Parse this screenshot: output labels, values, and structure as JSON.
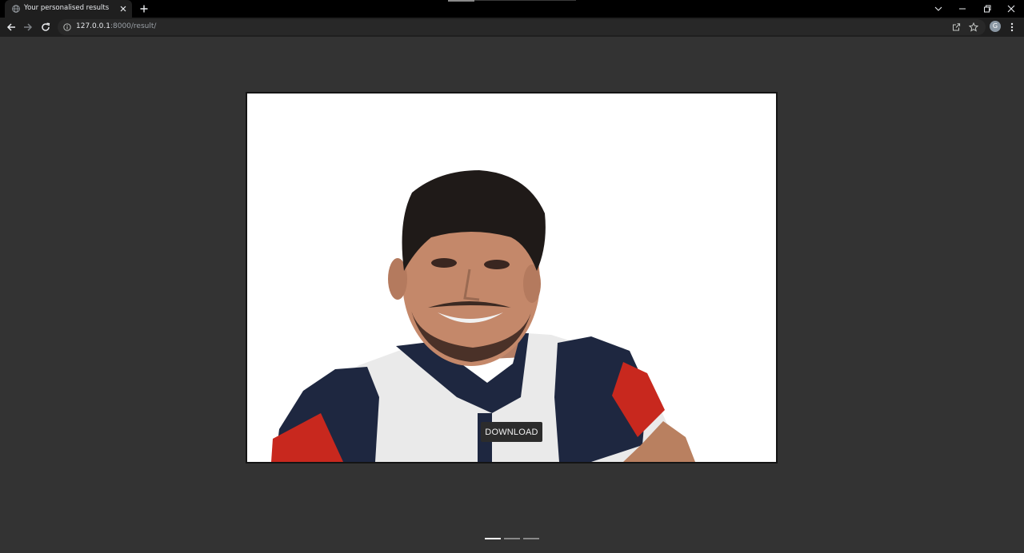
{
  "browser": {
    "tab": {
      "title": "Your personalised results"
    },
    "address": {
      "host": "127.0.0.1",
      "rest": ":8000/result/"
    },
    "profile": {
      "initial": "G"
    }
  },
  "page": {
    "download_label": "DOWNLOAD",
    "image_subject": "portrait of a smiling man in a white, navy and red polo shirt with background removed",
    "carousel": {
      "slides": 3,
      "active_index": 0
    }
  },
  "colors": {
    "page_background": "#333333",
    "tab_strip": "#000000",
    "toolbar": "#1f1f1f",
    "button_background": "#2c2c2c"
  }
}
